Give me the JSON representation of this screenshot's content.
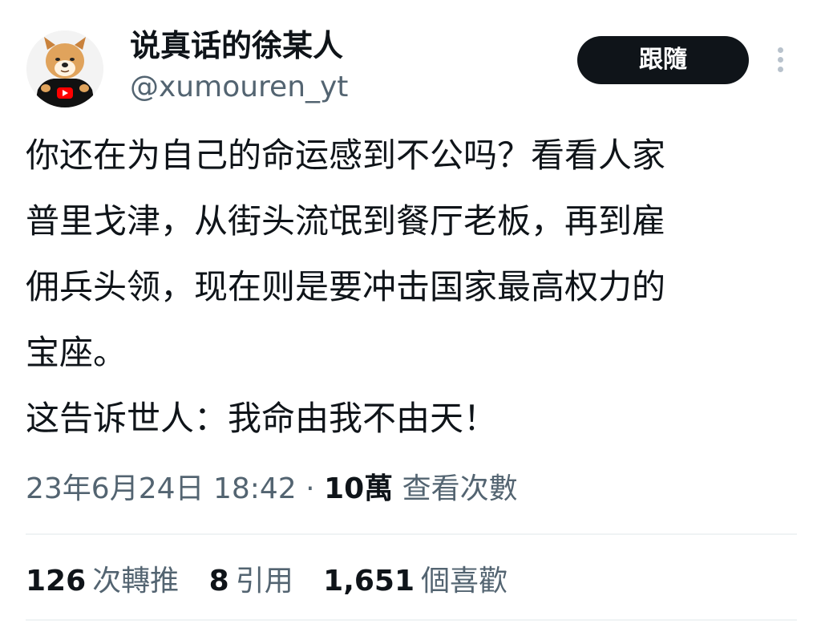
{
  "author": {
    "display_name": "说真话的徐某人",
    "handle": "@xumouren_yt",
    "avatar_icon": "cartoon-dog-avatar"
  },
  "follow_button_label": "跟隨",
  "more_icon": "more-vertical-icon",
  "tweet": {
    "paragraphs": [
      "你还在为自己的命运感到不公吗？看看人家",
      "普里戈津，从街头流氓到餐厅老板，再到雇",
      "佣兵头领，现在则是要冲击国家最高权力的",
      "宝座。",
      "这告诉世人：我命由我不由天！"
    ]
  },
  "meta": {
    "timestamp": "23年6月24日 18:42",
    "separator": "·",
    "views_count": "10萬",
    "views_label": "查看次數"
  },
  "stats": {
    "retweets_count": "126",
    "retweets_label": "次轉推",
    "quotes_count": "8",
    "quotes_label": "引用",
    "likes_count": "1,651",
    "likes_label": "個喜歡"
  },
  "colors": {
    "text_primary": "#0f1419",
    "text_secondary": "#536471",
    "button_bg": "#0f1419",
    "divider": "#eff3f4",
    "youtube_red": "#ff0000"
  }
}
